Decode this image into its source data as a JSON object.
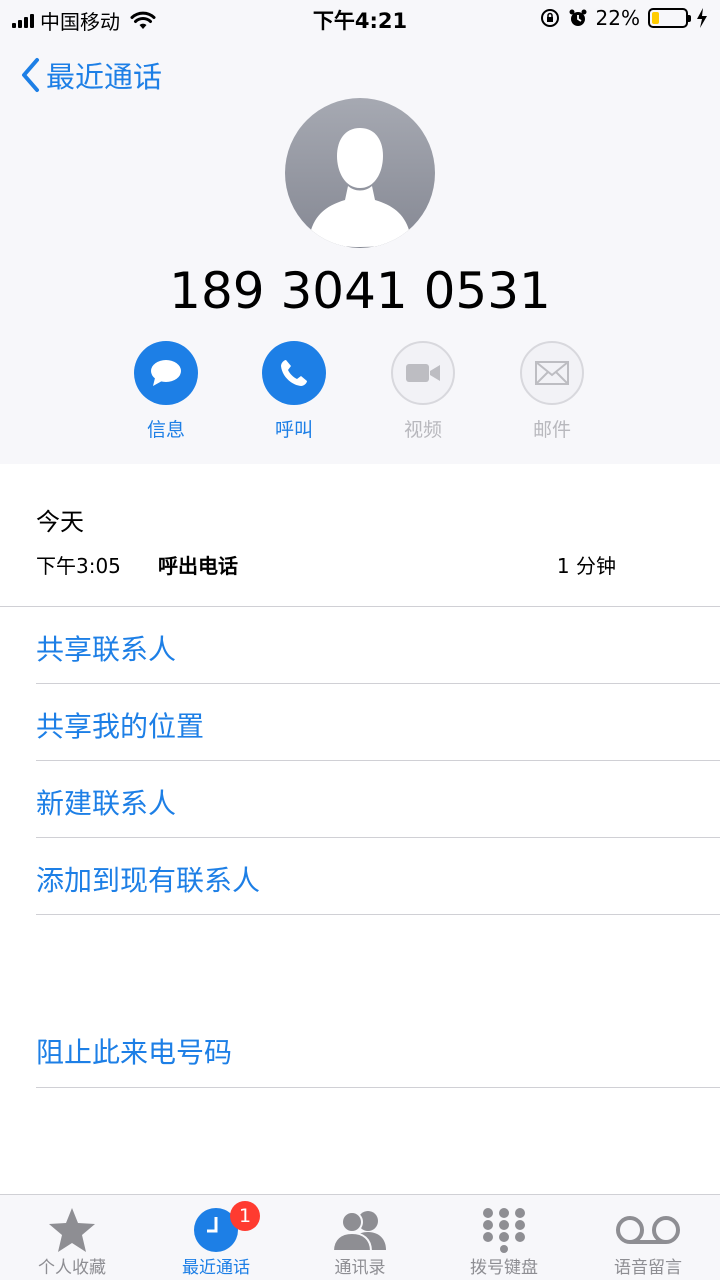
{
  "status": {
    "carrier": "中国移动",
    "time": "下午4:21",
    "battery": "22%",
    "battery_level": 0.22
  },
  "nav": {
    "back_label": "最近通话"
  },
  "contact": {
    "number": "189 3041 0531"
  },
  "actions": [
    {
      "label": "信息",
      "enabled": true
    },
    {
      "label": "呼叫",
      "enabled": true
    },
    {
      "label": "视频",
      "enabled": false
    },
    {
      "label": "邮件",
      "enabled": false
    }
  ],
  "history": {
    "day": "今天",
    "calls": [
      {
        "time": "下午3:05",
        "type": "呼出电话",
        "duration": "1 分钟"
      }
    ]
  },
  "options": [
    "共享联系人",
    "共享我的位置",
    "新建联系人",
    "添加到现有联系人"
  ],
  "block": "阻止此来电号码",
  "tabs": [
    {
      "label": "个人收藏",
      "icon": "star-icon"
    },
    {
      "label": "最近通话",
      "icon": "clock-icon",
      "active": true,
      "badge": "1"
    },
    {
      "label": "通讯录",
      "icon": "contacts-icon"
    },
    {
      "label": "拨号键盘",
      "icon": "keypad-icon"
    },
    {
      "label": "语音留言",
      "icon": "voicemail-icon"
    }
  ],
  "colors": {
    "accent": "#1d7fe6",
    "badge": "#ff3b30",
    "inactive": "#8e8e93"
  }
}
